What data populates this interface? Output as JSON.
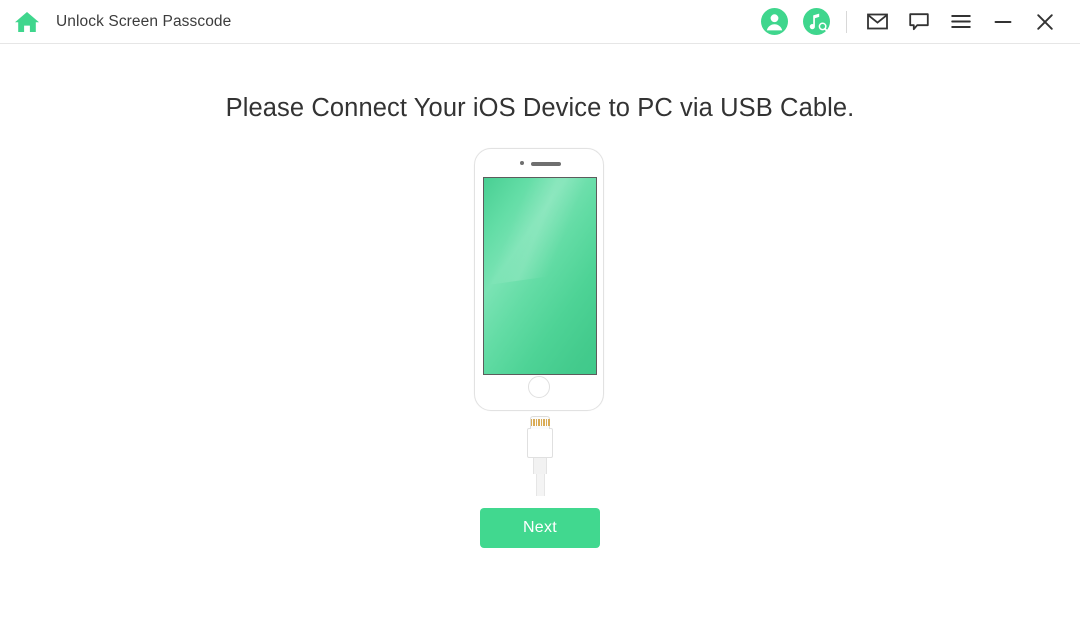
{
  "window": {
    "title": "Unlock Screen Passcode",
    "home_icon": "home-icon"
  },
  "titlebar": {
    "actions": [
      {
        "name": "account-icon",
        "label": "Account",
        "color": "#3fd68d"
      },
      {
        "name": "music-search-icon",
        "label": "Music Search",
        "color": "#3fd68d"
      },
      {
        "name": "mail-icon",
        "label": "Feedback"
      },
      {
        "name": "chat-icon",
        "label": "Support Chat"
      },
      {
        "name": "menu-icon",
        "label": "Menu"
      },
      {
        "name": "minimize-icon",
        "label": "Minimize"
      },
      {
        "name": "close-icon",
        "label": "Close"
      }
    ]
  },
  "main": {
    "headline": "Please Connect Your iOS Device to PC via USB Cable.",
    "device": {
      "type": "iphone-illustration",
      "screen_color": "#5ed79f"
    },
    "cable": {
      "type": "lightning-connector",
      "pin_color": "#d9ab55"
    },
    "next_button": {
      "label": "Next",
      "color": "#41d88f"
    }
  }
}
